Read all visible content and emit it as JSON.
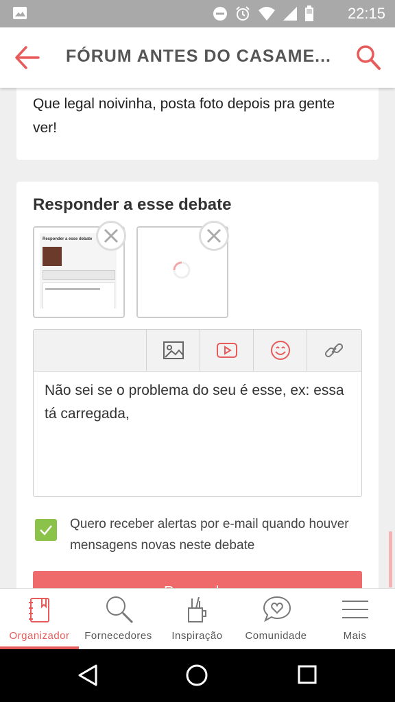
{
  "status_bar": {
    "time": "22:15"
  },
  "app_bar": {
    "title": "FÓRUM ANTES DO CASAME..."
  },
  "previous_message": {
    "text": "Que legal noivinha, posta foto depois pra gente ver!"
  },
  "reply": {
    "heading": "Responder a esse debate",
    "thumbnail_preview_title": "Responder a esse debate",
    "editor_text": "Não sei se o problema do seu é esse, ex: essa tá carregada,",
    "checkbox_label": "Quero receber alertas por e-mail quando houver mensagens novas neste debate",
    "checkbox_checked": true,
    "submit_label": "Responder"
  },
  "bottom_nav": {
    "items": [
      {
        "label": "Organizador",
        "icon": "notebook-icon",
        "active": true
      },
      {
        "label": "Fornecedores",
        "icon": "search-icon",
        "active": false
      },
      {
        "label": "Inspiração",
        "icon": "brushes-cup-icon",
        "active": false
      },
      {
        "label": "Comunidade",
        "icon": "heart-chat-icon",
        "active": false
      },
      {
        "label": "Mais",
        "icon": "menu-icon",
        "active": false
      }
    ]
  },
  "colors": {
    "accent": "#e75b5b",
    "check": "#8bc34a",
    "status_bar": "#a9a9a9"
  }
}
